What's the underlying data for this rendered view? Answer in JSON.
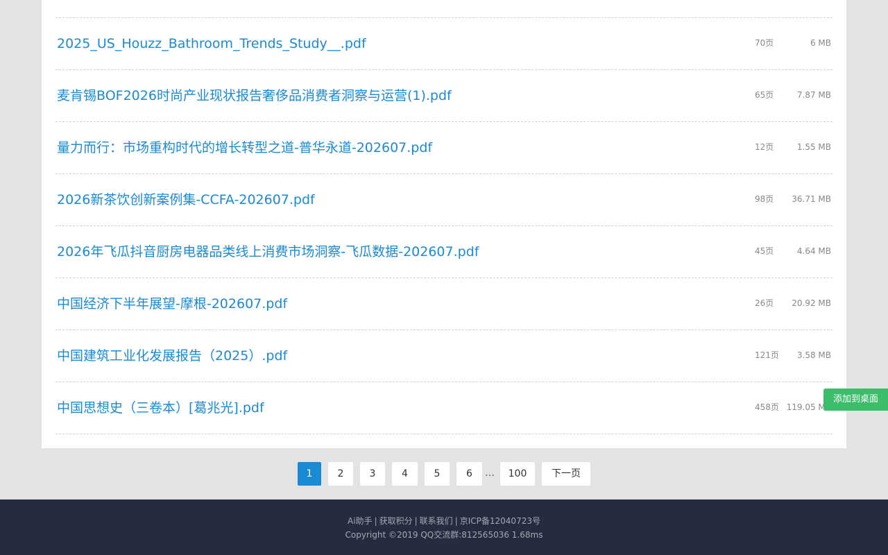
{
  "files": [
    {
      "title": "2025_US_Houzz_Bathroom_Trends_Study__.pdf",
      "pages": "70页",
      "size": "6 MB"
    },
    {
      "title": "麦肯锡BOF2026时尚产业现状报告奢侈品消费者洞察与运营(1).pdf",
      "pages": "65页",
      "size": "7.87 MB"
    },
    {
      "title": "量力而行：市场重构时代的增长转型之道-普华永道-202607.pdf",
      "pages": "12页",
      "size": "1.55 MB"
    },
    {
      "title": "2026新茶饮创新案例集-CCFA-202607.pdf",
      "pages": "98页",
      "size": "36.71 MB"
    },
    {
      "title": "2026年飞瓜抖音厨房电器品类线上消费市场洞察-飞瓜数据-202607.pdf",
      "pages": "45页",
      "size": "4.64 MB"
    },
    {
      "title": "中国经济下半年展望-摩根-202607.pdf",
      "pages": "26页",
      "size": "20.92 MB"
    },
    {
      "title": "中国建筑工业化发展报告（2025）.pdf",
      "pages": "121页",
      "size": "3.58 MB"
    },
    {
      "title": "中国思想史（三卷本）[葛兆光].pdf",
      "pages": "458页",
      "size": "119.05 MB"
    }
  ],
  "pagination": {
    "pages": [
      "1",
      "2",
      "3",
      "4",
      "5",
      "6"
    ],
    "current": "1",
    "ellipsis": "…",
    "last": "100",
    "next_label": "下一页"
  },
  "footer": {
    "links": [
      "Ai助手",
      "获取积分",
      "联系我们",
      "京ICP备12040723号"
    ],
    "separator": "|",
    "copyright": "Copyright ©2019 QQ交流群:812565036 1.68ms"
  },
  "add_to_desktop_label": "添加到桌面",
  "colors": {
    "link": "#1a8ad4",
    "active_page": "#1a8ad4",
    "footer_bg": "#272b40",
    "add_button": "#3bbd6a"
  }
}
